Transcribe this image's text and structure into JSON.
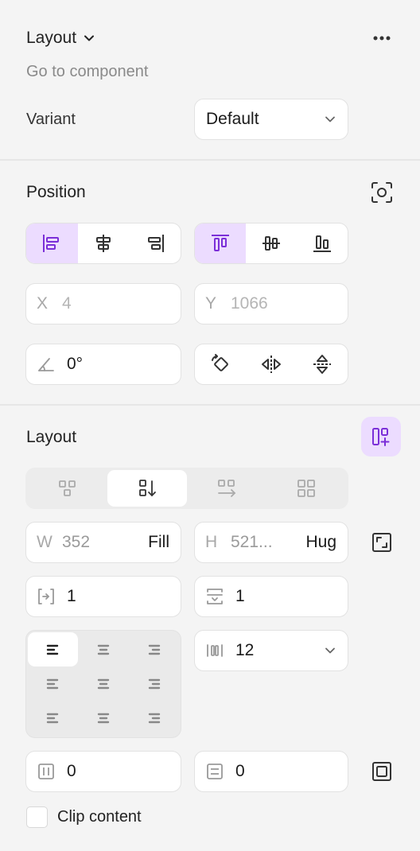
{
  "header": {
    "title": "Layout",
    "go_to_component": "Go to component",
    "variant_label": "Variant",
    "variant_value": "Default"
  },
  "position": {
    "title": "Position",
    "x_label": "X",
    "x_value": "4",
    "y_label": "Y",
    "y_value": "1066",
    "rotation_value": "0°"
  },
  "layout": {
    "title": "Layout",
    "w_label": "W",
    "w_value": "352",
    "w_mode": "Fill",
    "h_label": "H",
    "h_value": "521...",
    "h_mode": "Hug",
    "padding_h": "1",
    "padding_v": "1",
    "gap_value": "12",
    "clip_h": "0",
    "clip_v": "0",
    "clip_content_label": "Clip content"
  },
  "colors": {
    "accent": "#7b2fd8",
    "accent_bg": "#ecdcff",
    "panel_bg": "#f4f4f4"
  }
}
